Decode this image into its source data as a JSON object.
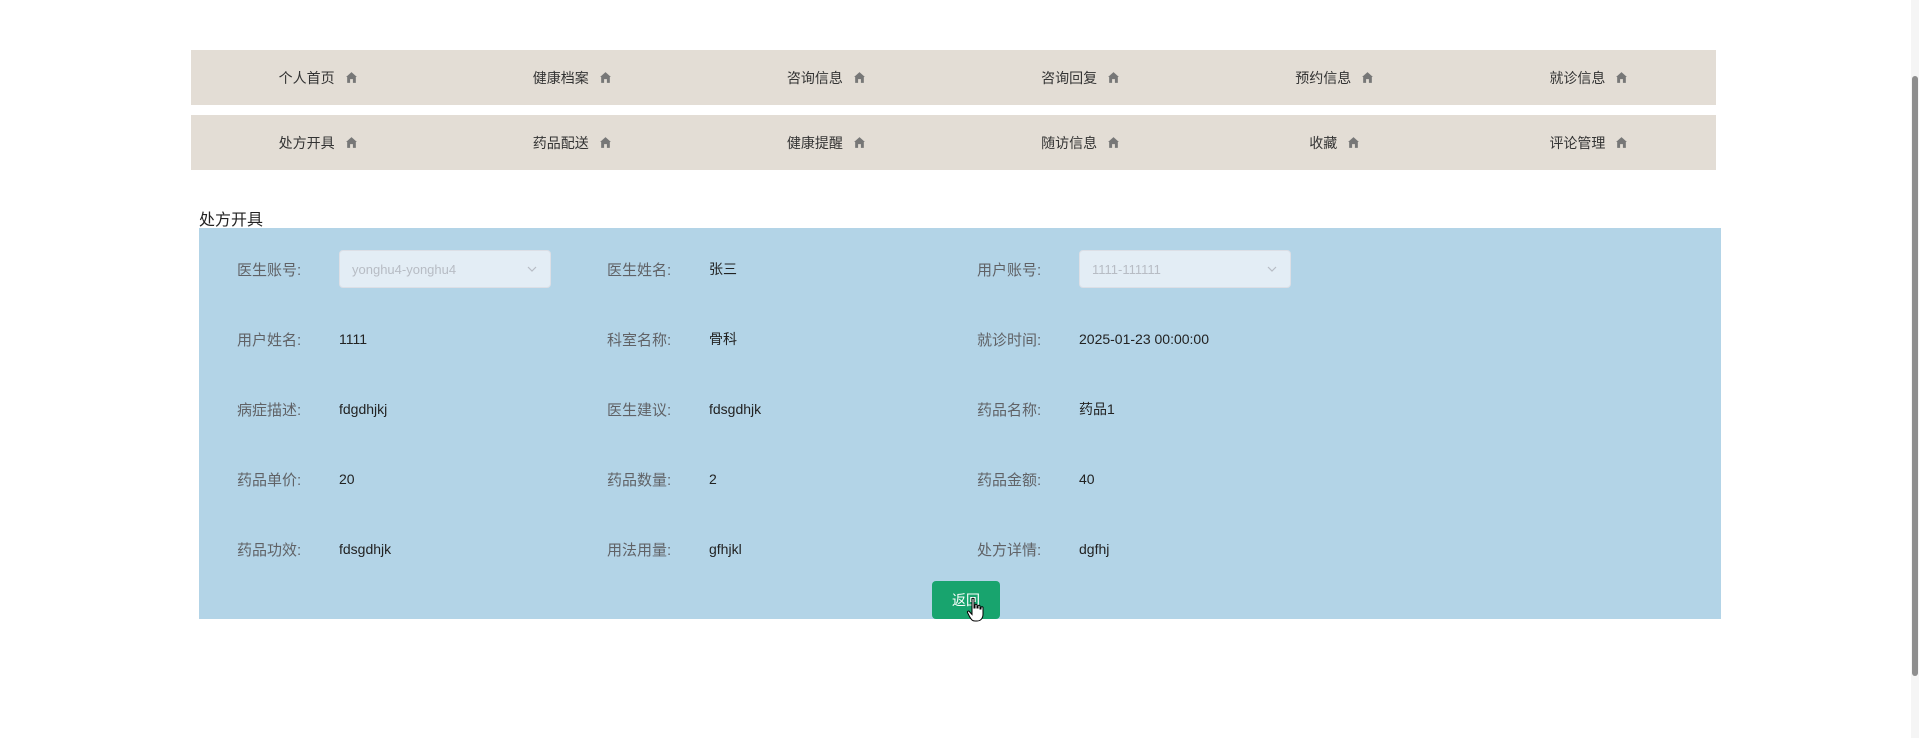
{
  "nav": {
    "row1": [
      {
        "label": "个人首页"
      },
      {
        "label": "健康档案"
      },
      {
        "label": "咨询信息"
      },
      {
        "label": "咨询回复"
      },
      {
        "label": "预约信息"
      },
      {
        "label": "就诊信息"
      }
    ],
    "row2": [
      {
        "label": "处方开具"
      },
      {
        "label": "药品配送"
      },
      {
        "label": "健康提醒"
      },
      {
        "label": "随访信息"
      },
      {
        "label": "收藏"
      },
      {
        "label": "评论管理"
      }
    ]
  },
  "section_title": "处方开具",
  "form": {
    "doctor_account": {
      "label": "医生账号:",
      "value": "yonghu4-yonghu4"
    },
    "doctor_name": {
      "label": "医生姓名:",
      "value": "张三"
    },
    "user_account": {
      "label": "用户账号:",
      "value": "1111-111111"
    },
    "user_name": {
      "label": "用户姓名:",
      "value": "1111"
    },
    "department": {
      "label": "科室名称:",
      "value": "骨科"
    },
    "visit_time": {
      "label": "就诊时间:",
      "value": "2025-01-23 00:00:00"
    },
    "symptoms": {
      "label": "病症描述:",
      "value": "fdgdhjkj"
    },
    "advice": {
      "label": "医生建议:",
      "value": "fdsgdhjk"
    },
    "drug_name": {
      "label": "药品名称:",
      "value": "药品1"
    },
    "unit_price": {
      "label": "药品单价:",
      "value": "20"
    },
    "quantity": {
      "label": "药品数量:",
      "value": "2"
    },
    "amount": {
      "label": "药品金额:",
      "value": "40"
    },
    "efficacy": {
      "label": "药品功效:",
      "value": "fdsgdhjk"
    },
    "dosage": {
      "label": "用法用量:",
      "value": "gfhjkl"
    },
    "details": {
      "label": "处方详情:",
      "value": "dgfhj"
    }
  },
  "back_button": "返回",
  "colors": {
    "nav_bg": "#e3ddd5",
    "panel_bg": "#b3d4e7",
    "button_bg": "#18a46e"
  }
}
